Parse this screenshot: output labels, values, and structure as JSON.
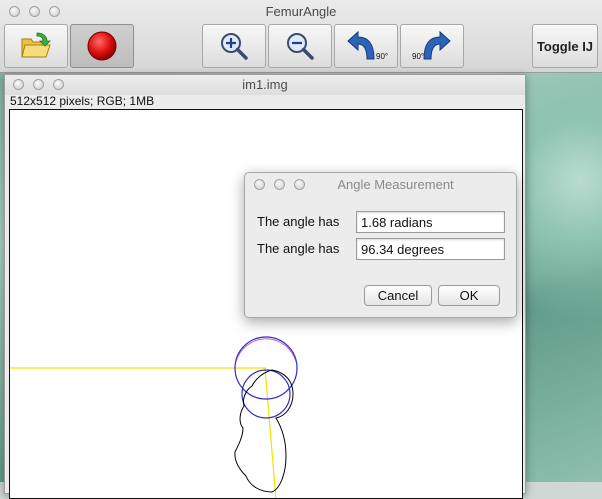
{
  "app": {
    "title": "FemurAngle",
    "toolbar": {
      "open_icon": "folder-open-icon",
      "record_icon": "red-circle-icon",
      "zoom_in_icon": "zoom-in-icon",
      "zoom_out_icon": "zoom-out-icon",
      "rotate_left_label": "90°",
      "rotate_right_label": "90°",
      "toggle_label": "Toggle IJ"
    }
  },
  "image_window": {
    "title": "im1.img",
    "info": "512x512 pixels; RGB; 1MB"
  },
  "dialog": {
    "title": "Angle Measurement",
    "radians_label": "The angle has",
    "radians_value": "1.68 radians",
    "degrees_label": "The angle has",
    "degrees_value": "96.34 degrees",
    "cancel_label": "Cancel",
    "ok_label": "OK"
  },
  "colors": {
    "axis_line": "#f2e300",
    "circle_outer": "#2e2ec8",
    "circle_accent": "#c040c0",
    "outline": "#000000"
  }
}
